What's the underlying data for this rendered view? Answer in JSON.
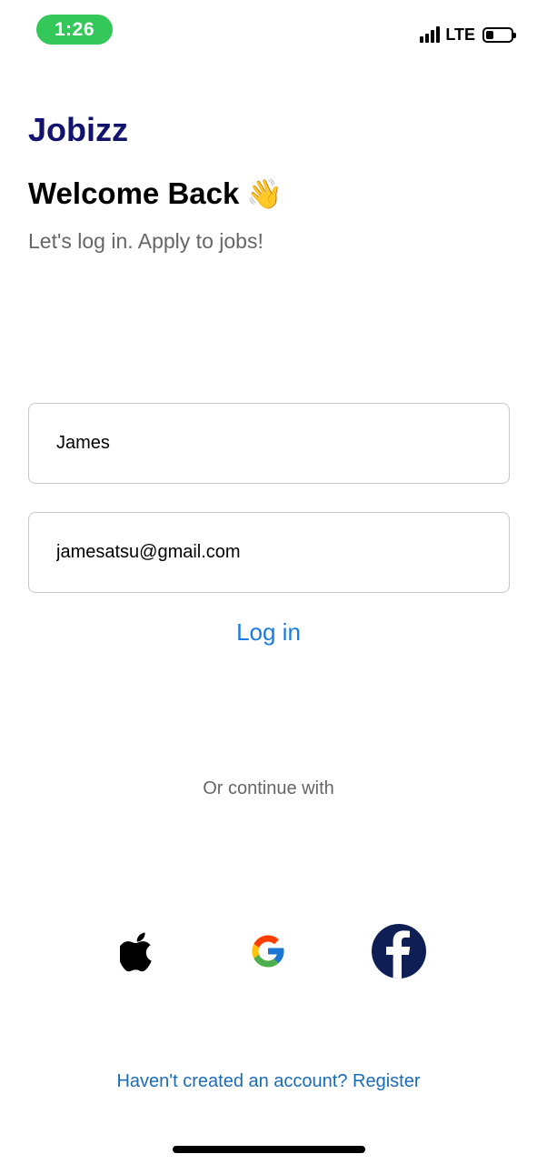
{
  "status_bar": {
    "time": "1:26",
    "network": "LTE",
    "icons": [
      "signal-icon",
      "battery-icon"
    ]
  },
  "brand": {
    "name": "Jobizz",
    "color": "#12136f"
  },
  "header": {
    "title": "Welcome Back",
    "emoji": "👋",
    "subtitle": "Let's log in. Apply to jobs!"
  },
  "form": {
    "name_value": "James",
    "email_value": "jamesatsu@gmail.com",
    "login_label": "Log in"
  },
  "social": {
    "divider_text": "Or continue with",
    "providers": [
      {
        "name": "apple",
        "icon": "apple-icon"
      },
      {
        "name": "google",
        "icon": "google-icon"
      },
      {
        "name": "facebook",
        "icon": "facebook-icon"
      }
    ]
  },
  "footer": {
    "register_text": "Haven't created an account? Register"
  },
  "colors": {
    "accent": "#1a7be0",
    "status_pill": "#34c759",
    "facebook": "#0f1f56"
  }
}
